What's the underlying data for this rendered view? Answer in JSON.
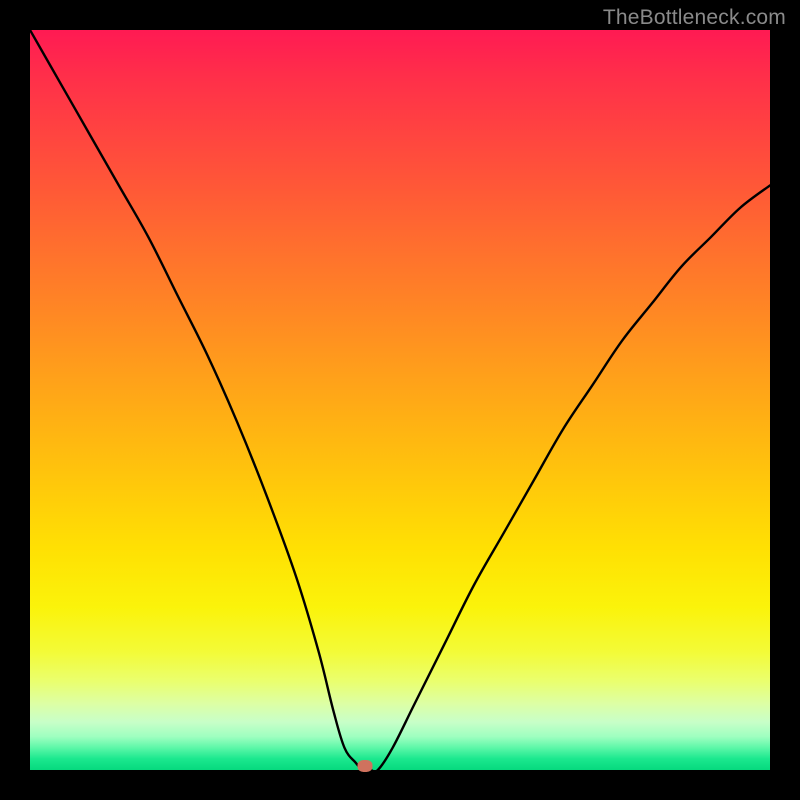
{
  "watermark": "TheBottleneck.com",
  "chart_data": {
    "type": "line",
    "title": "",
    "xlabel": "",
    "ylabel": "",
    "xlim": [
      0,
      100
    ],
    "ylim": [
      0,
      100
    ],
    "grid": false,
    "series": [
      {
        "name": "curve",
        "x": [
          0,
          4,
          8,
          12,
          16,
          20,
          24,
          28,
          32,
          36,
          39,
          41,
          42.5,
          44,
          45,
          46,
          47,
          49,
          52,
          56,
          60,
          64,
          68,
          72,
          76,
          80,
          84,
          88,
          92,
          96,
          100
        ],
        "y": [
          100,
          93,
          86,
          79,
          72,
          64,
          56,
          47,
          37,
          26,
          16,
          8,
          3,
          1,
          0,
          0,
          0,
          3,
          9,
          17,
          25,
          32,
          39,
          46,
          52,
          58,
          63,
          68,
          72,
          76,
          79
        ]
      }
    ],
    "marker": {
      "x": 45.3,
      "y": 0.6
    },
    "gradient_stops": [
      {
        "pos": 0,
        "color": "#ff1a53"
      },
      {
        "pos": 50,
        "color": "#ffb000"
      },
      {
        "pos": 80,
        "color": "#ffef00"
      },
      {
        "pos": 100,
        "color": "#06d97e"
      }
    ]
  }
}
